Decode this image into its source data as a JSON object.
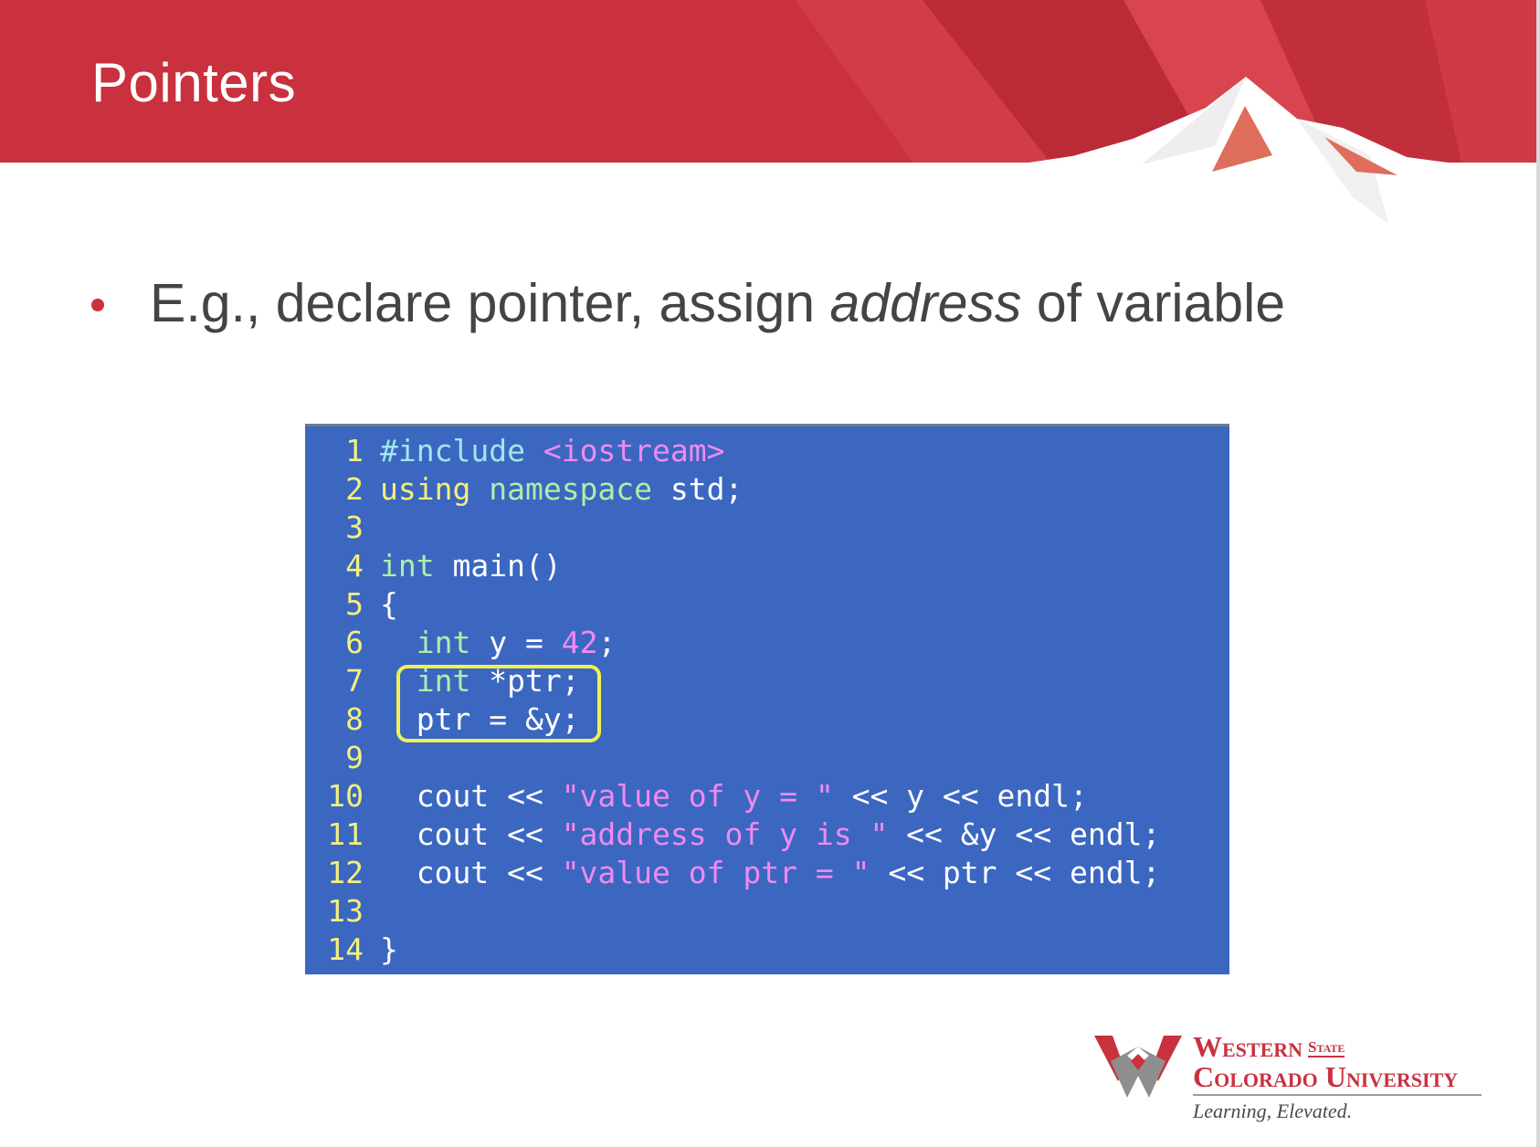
{
  "slide": {
    "title": "Pointers",
    "bullet": {
      "prefix": "E.g., declare pointer, assign ",
      "emphasis": "address",
      "suffix": " of variable"
    }
  },
  "code": {
    "lines": [
      {
        "num": "1",
        "tokens": [
          {
            "t": "#include",
            "c": "pp"
          },
          {
            "t": " ",
            "c": "plain"
          },
          {
            "t": "<iostream>",
            "c": "str"
          }
        ]
      },
      {
        "num": "2",
        "tokens": [
          {
            "t": "using",
            "c": "kw"
          },
          {
            "t": " ",
            "c": "plain"
          },
          {
            "t": "namespace",
            "c": "ty"
          },
          {
            "t": " std;",
            "c": "plain"
          }
        ]
      },
      {
        "num": "3",
        "tokens": []
      },
      {
        "num": "4",
        "tokens": [
          {
            "t": "int",
            "c": "ty"
          },
          {
            "t": " main()",
            "c": "plain"
          }
        ]
      },
      {
        "num": "5",
        "tokens": [
          {
            "t": "{",
            "c": "plain"
          }
        ]
      },
      {
        "num": "6",
        "tokens": [
          {
            "t": "  ",
            "c": "plain"
          },
          {
            "t": "int",
            "c": "ty"
          },
          {
            "t": " y = ",
            "c": "plain"
          },
          {
            "t": "42",
            "c": "num"
          },
          {
            "t": ";",
            "c": "plain"
          }
        ]
      },
      {
        "num": "7",
        "tokens": [
          {
            "t": "  ",
            "c": "plain"
          },
          {
            "t": "int",
            "c": "ty"
          },
          {
            "t": " *ptr;",
            "c": "plain"
          }
        ]
      },
      {
        "num": "8",
        "tokens": [
          {
            "t": "  ptr = &y;",
            "c": "plain"
          }
        ]
      },
      {
        "num": "9",
        "tokens": []
      },
      {
        "num": "10",
        "tokens": [
          {
            "t": "  cout << ",
            "c": "plain"
          },
          {
            "t": "\"value of y = \"",
            "c": "str"
          },
          {
            "t": " << y << endl;",
            "c": "plain"
          }
        ]
      },
      {
        "num": "11",
        "tokens": [
          {
            "t": "  cout << ",
            "c": "plain"
          },
          {
            "t": "\"address of y is \"",
            "c": "str"
          },
          {
            "t": " << &y << endl;",
            "c": "plain"
          }
        ]
      },
      {
        "num": "12",
        "tokens": [
          {
            "t": "  cout << ",
            "c": "plain"
          },
          {
            "t": "\"value of ptr = \"",
            "c": "str"
          },
          {
            "t": " << ptr << endl;",
            "c": "plain"
          }
        ]
      },
      {
        "num": "13",
        "tokens": []
      },
      {
        "num": "14",
        "tokens": [
          {
            "t": "}",
            "c": "plain"
          }
        ]
      }
    ],
    "highlighted_lines": [
      "7",
      "8"
    ]
  },
  "logo": {
    "line1": "Western",
    "state": "State",
    "line2": "Colorado University",
    "tagline": "Learning, Elevated."
  },
  "colors": {
    "header_red": "#c9313f",
    "code_background": "#3b67c1",
    "highlight_box": "#f3ef52",
    "bullet_text": "#444444"
  }
}
